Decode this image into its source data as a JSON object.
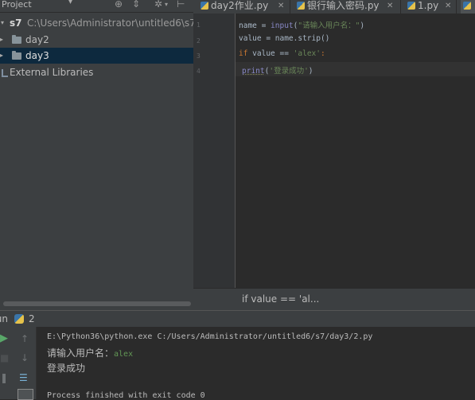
{
  "project": {
    "title": "Project",
    "root": {
      "name": "s7",
      "path": "C:\\Users\\Administrator\\untitled6\\s7"
    },
    "folders": [
      {
        "name": "day2"
      },
      {
        "name": "day3"
      }
    ],
    "external": "External Libraries"
  },
  "tabs": [
    {
      "label": "day2作业.py",
      "active": false
    },
    {
      "label": "银行输入密码.py",
      "active": false
    },
    {
      "label": "1.py",
      "active": false
    }
  ],
  "editor": {
    "line_numbers": [
      "1",
      "2",
      "3",
      "4"
    ],
    "lines": [
      {
        "t1": "name = ",
        "f": "input",
        "t2": "(",
        "s": "\"请输入用户名：\"",
        "t3": ")"
      },
      {
        "text": "value = name.strip()"
      },
      {
        "kw": "if",
        "t1": " value == ",
        "s": "'alex'",
        "t2": ":"
      },
      {
        "f": "print",
        "t1": "(",
        "s": "'登录成功'",
        "t2": ")"
      }
    ]
  },
  "breadcrumb": "if value == 'al...",
  "run": {
    "label": "Run",
    "config_name": "2",
    "console": {
      "command": "E:\\Python36\\python.exe C:/Users/Administrator/untitled6/s7/day3/2.py",
      "prompt": "请输入用户名：",
      "input": "alex",
      "output": "登录成功",
      "finished": "Process finished with exit code 0"
    }
  },
  "colors": {
    "keyword": "#cc7832",
    "string": "#6a8759",
    "builtin": "#8888c6",
    "selection": "#0d293e",
    "input_text": "#629755"
  }
}
